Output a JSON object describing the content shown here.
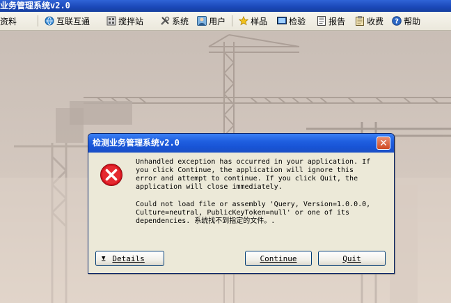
{
  "app": {
    "title": "业务管理系统v2.0"
  },
  "menu": {
    "items": [
      {
        "label": "资料",
        "icon": "data-icon"
      },
      {
        "label": "互联互通",
        "icon": "network-icon"
      },
      {
        "label": "搅拌站",
        "icon": "mixing-station-icon"
      },
      {
        "label": "系统",
        "icon": "tools-icon"
      },
      {
        "label": "用户",
        "icon": "user-icon"
      },
      {
        "label": "样品",
        "icon": "star-icon"
      },
      {
        "label": "检验",
        "icon": "monitor-icon"
      },
      {
        "label": "报告",
        "icon": "report-icon"
      },
      {
        "label": "收费",
        "icon": "clipboard-icon"
      },
      {
        "label": "帮助",
        "icon": "help-icon"
      }
    ]
  },
  "dialog": {
    "title": "检测业务管理系统v2.0",
    "close_glyph": "✕",
    "message": "Unhandled exception has occurred in your application. If\nyou click Continue, the application will ignore this\nerror and attempt to continue. If you click Quit, the\napplication will close immediately.",
    "detail": "Could not load file or assembly 'Query, Version=1.0.0.0,\nCulture=neutral, PublicKeyToken=null' or one of its\ndependencies. 系统找不到指定的文件。.",
    "buttons": {
      "details": "Details",
      "continue": "Continue",
      "quit": "Quit"
    }
  },
  "colors": {
    "title_bar": "#1f5fe0",
    "dialog_bg": "#ece9d8",
    "error_red": "#d8141e"
  }
}
